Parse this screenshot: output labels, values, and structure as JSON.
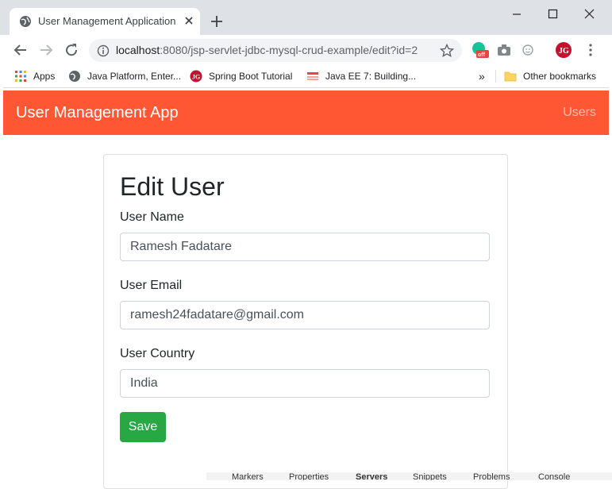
{
  "browser": {
    "tab": {
      "title": "User Management Application",
      "favicon": "globe-icon"
    },
    "url": {
      "host": "localhost",
      "rest": ":8080/jsp-servlet-jdbc-mysql-crud-example/edit?id=2"
    },
    "extensions": [
      "grammarly-icon",
      "camera-icon",
      "smiley-icon",
      "profile-avatar-icon"
    ],
    "bookmarks": [
      {
        "label": "Apps",
        "icon": "apps-grid-icon"
      },
      {
        "label": "Java Platform, Enter...",
        "icon": "globe-icon"
      },
      {
        "label": "Spring Boot Tutorial",
        "icon": "jg-logo-icon"
      },
      {
        "label": "Java EE 7: Building...",
        "icon": "oracle-icon"
      }
    ],
    "more_bookmarks": "»",
    "other_bookmarks": "Other bookmarks"
  },
  "app": {
    "brand": "User Management App",
    "nav_link": "Users",
    "form_title": "Edit User",
    "fields": [
      {
        "label": "User Name",
        "value": "Ramesh Fadatare"
      },
      {
        "label": "User Email",
        "value": "ramesh24fadatare@gmail.com"
      },
      {
        "label": "User Country",
        "value": "India"
      }
    ],
    "save_label": "Save"
  },
  "colors": {
    "navbar": "#ff5733",
    "save": "#28a745",
    "chrome": "#dee1e6"
  },
  "background_ide": {
    "tabs": [
      "Markers",
      "Properties",
      "Servers",
      "Snippets",
      "Problems",
      "Console"
    ]
  }
}
